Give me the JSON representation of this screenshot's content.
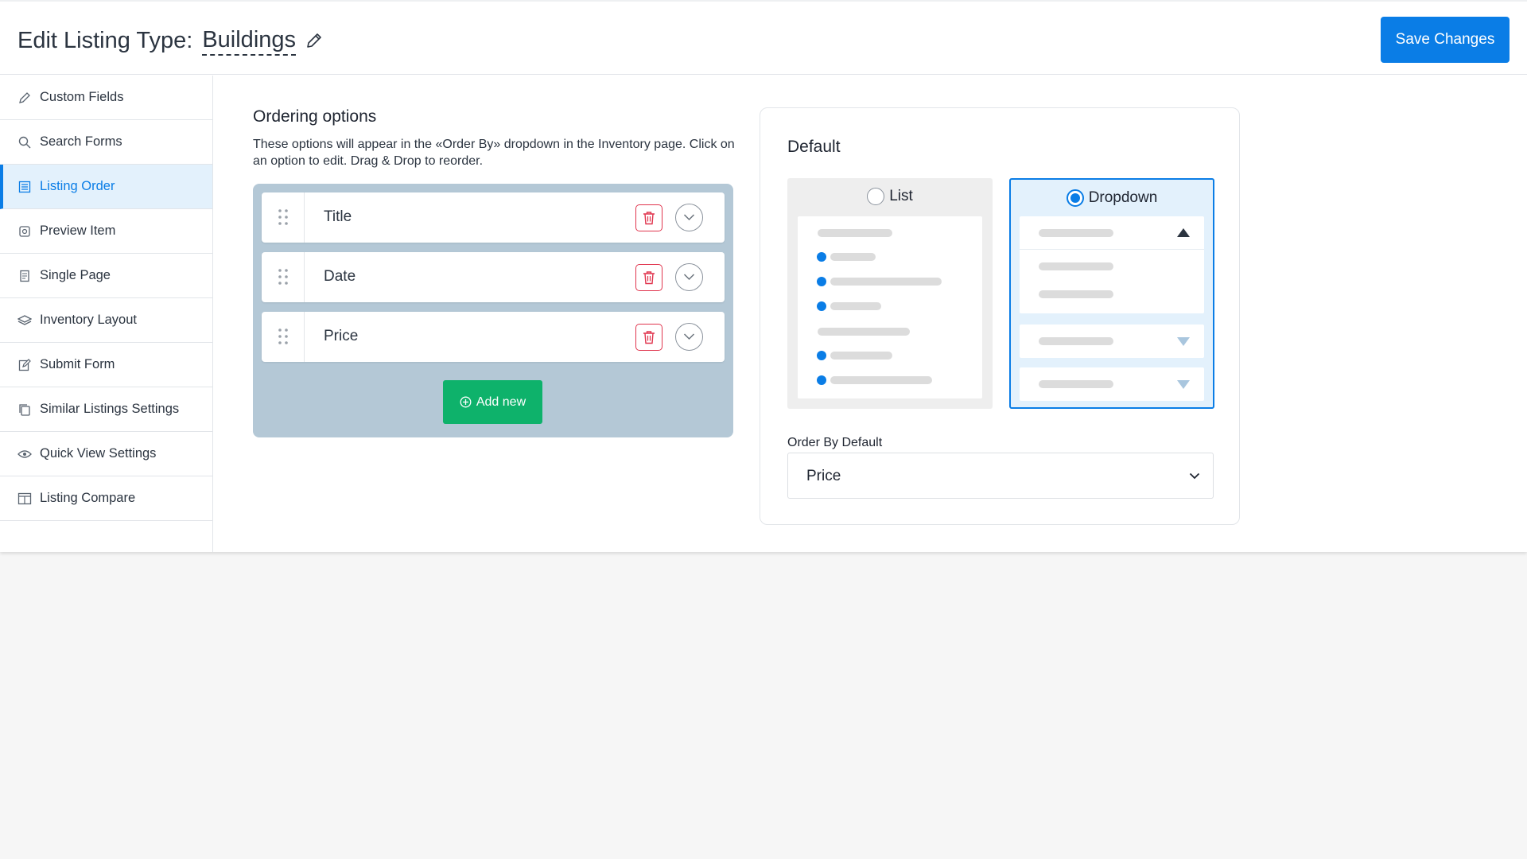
{
  "header": {
    "title_prefix": "Edit Listing Type:",
    "listing_name": "Buildings",
    "save_label": "Save Changes"
  },
  "sidebar": {
    "items": [
      {
        "label": "Custom Fields",
        "icon": "pencil-icon"
      },
      {
        "label": "Search Forms",
        "icon": "search-icon"
      },
      {
        "label": "Listing Order",
        "icon": "list-order-icon",
        "active": true
      },
      {
        "label": "Preview Item",
        "icon": "preview-icon"
      },
      {
        "label": "Single Page",
        "icon": "page-icon"
      },
      {
        "label": "Inventory Layout",
        "icon": "layers-icon"
      },
      {
        "label": "Submit Form",
        "icon": "edit-form-icon"
      },
      {
        "label": "Similar Listings Settings",
        "icon": "copy-icon"
      },
      {
        "label": "Quick View Settings",
        "icon": "eye-icon"
      },
      {
        "label": "Listing Compare",
        "icon": "compare-icon"
      }
    ]
  },
  "ordering": {
    "title": "Ordering options",
    "description": "These options will appear in the «Order By» dropdown in the Inventory page. Click on an option to edit. Drag & Drop to reorder.",
    "options": [
      {
        "label": "Title"
      },
      {
        "label": "Date"
      },
      {
        "label": "Price"
      }
    ],
    "add_label": "Add new"
  },
  "default": {
    "title": "Default",
    "display_options": [
      {
        "label": "List",
        "selected": false
      },
      {
        "label": "Dropdown",
        "selected": true
      }
    ],
    "order_by_label": "Order By Default",
    "order_by_value": "Price"
  },
  "colors": {
    "accent": "#0a7de6",
    "success": "#0eb26b",
    "danger": "#e0344d",
    "order_panel_bg": "#b4c8d6"
  }
}
